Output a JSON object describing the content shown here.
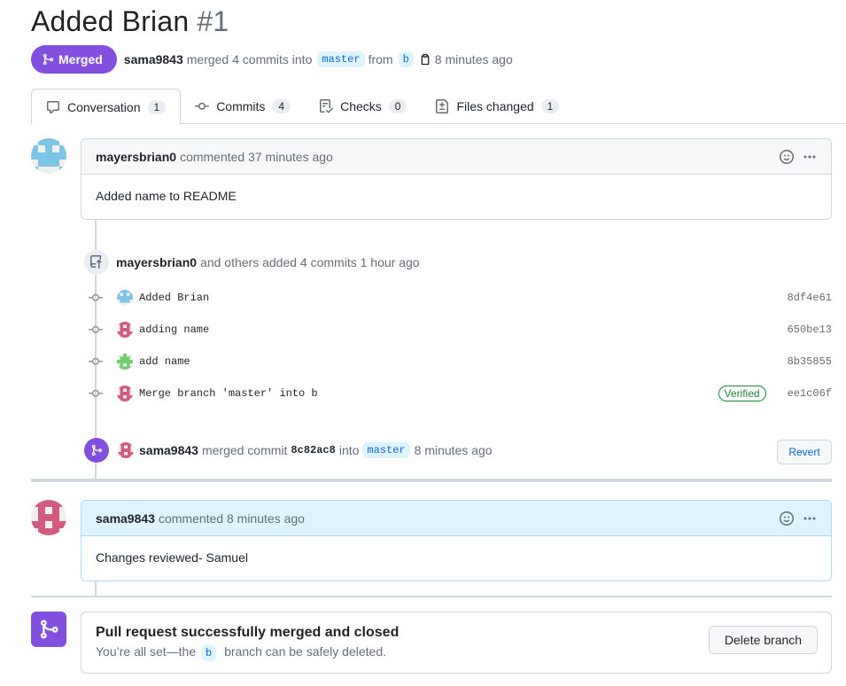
{
  "pr": {
    "title": "Added Brian",
    "number": "#1",
    "status": "Merged",
    "author": "sama9843",
    "action": "merged 4 commits into",
    "base_branch": "master",
    "from_word": "from",
    "head_branch": "b",
    "time": "8 minutes ago"
  },
  "tabs": [
    {
      "label": "Conversation",
      "count": "1",
      "icon": "comment-icon"
    },
    {
      "label": "Commits",
      "count": "4",
      "icon": "commit-icon"
    },
    {
      "label": "Checks",
      "count": "0",
      "icon": "checklist-icon"
    },
    {
      "label": "Files changed",
      "count": "1",
      "icon": "file-diff-icon"
    }
  ],
  "comment1": {
    "author": "mayersbrian0",
    "meta": "commented 37 minutes ago",
    "body": "Added name to README"
  },
  "commits_event": {
    "author": "mayersbrian0",
    "meta": "and others added 4 commits 1 hour ago",
    "items": [
      {
        "message": "Added Brian",
        "sha": "8df4e61",
        "verified": ""
      },
      {
        "message": "adding name",
        "sha": "650be13",
        "verified": ""
      },
      {
        "message": "add name",
        "sha": "8b35855",
        "verified": ""
      },
      {
        "message": "Merge branch 'master' into b",
        "sha": "ee1c06f",
        "verified": "Verified"
      }
    ]
  },
  "merge_event": {
    "author": "sama9843",
    "text1": "merged commit",
    "commit": "8c82ac8",
    "text2": "into",
    "branch": "master",
    "time": "8 minutes ago",
    "revert_label": "Revert"
  },
  "comment2": {
    "author": "sama9843",
    "meta": "commented 8 minutes ago",
    "body": "Changes reviewed- Samuel"
  },
  "merge_box": {
    "heading": "Pull request successfully merged and closed",
    "sub_before": "You’re all set—the",
    "branch": "b",
    "sub_after": "branch can be safely deleted.",
    "delete_label": "Delete branch"
  },
  "colors": {
    "merged_purple": "#8250df",
    "link_blue": "#0969da",
    "verified_green": "#1a7f37"
  }
}
